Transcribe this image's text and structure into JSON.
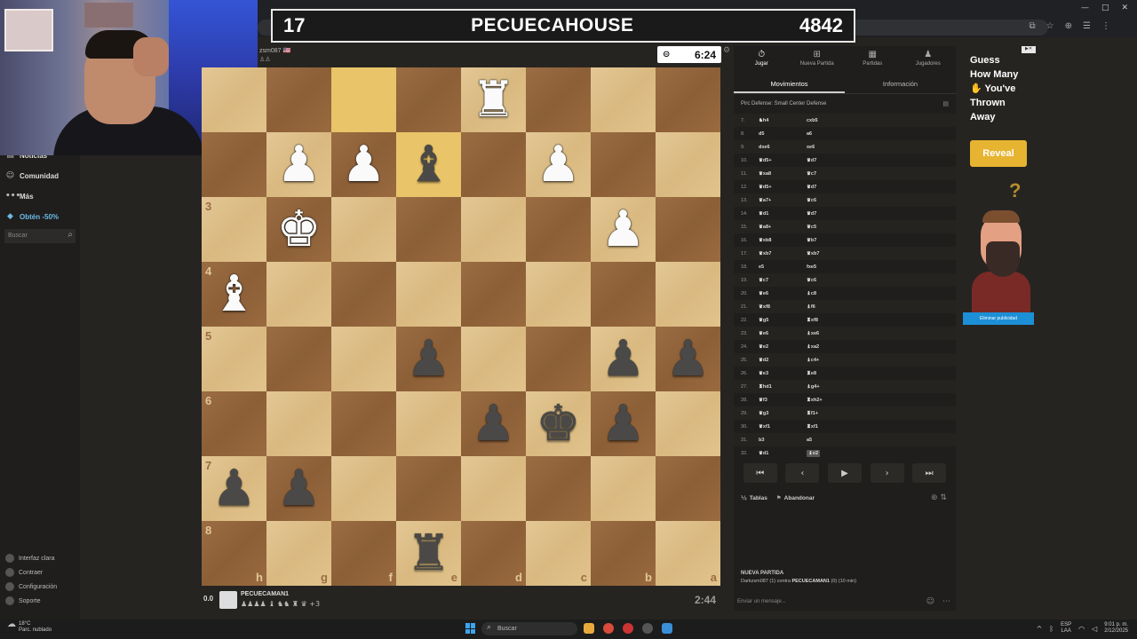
{
  "banner": {
    "left": "17",
    "name": "PECUECAHOUSE",
    "right": "4842"
  },
  "opponent": {
    "name": "zsm087",
    "flag": "🇺🇸",
    "pieces": "♙♙"
  },
  "top_clock": {
    "icon": "stopwatch-icon",
    "time": "6:24"
  },
  "player": {
    "eval": "0.0",
    "name": "PECUECAMAN1",
    "captured": "♟♟♟♟ ♝ ♞♞ ♜ ♛ +3"
  },
  "bottom_clock": {
    "time": "2:44"
  },
  "sidebar": {
    "items": [
      {
        "label": "Noticias",
        "icon": "news-icon",
        "glyph": "▤"
      },
      {
        "label": "Comunidad",
        "icon": "community-icon",
        "glyph": "☺"
      },
      {
        "label": "Más",
        "icon": "more-icon",
        "glyph": "•••"
      },
      {
        "label": "Obtén -50%",
        "icon": "diamond-icon",
        "glyph": "◆"
      }
    ],
    "search_placeholder": "Buscar",
    "bottom": [
      {
        "label": "Interfaz clara"
      },
      {
        "label": "Contraer"
      },
      {
        "label": "Configuración"
      },
      {
        "label": "Soporte"
      }
    ]
  },
  "board": {
    "ranks": [
      "",
      "",
      "3",
      "4",
      "5",
      "6",
      "7",
      "8"
    ],
    "files": [
      "h",
      "g",
      "f",
      "e",
      "d",
      "c",
      "b",
      "a"
    ],
    "rows": [
      [
        "",
        "",
        "",
        "",
        "♜",
        "",
        "",
        ""
      ],
      [
        "",
        "♟",
        "♟",
        "♝",
        "",
        "♟",
        "",
        ""
      ],
      [
        "",
        "♚",
        "",
        "",
        "",
        "",
        "♟",
        ""
      ],
      [
        "♝",
        "",
        "",
        "",
        "",
        "",
        "",
        ""
      ],
      [
        "",
        "",
        "",
        "♟",
        "",
        "",
        "♟",
        "♟"
      ],
      [
        "",
        "",
        "",
        "",
        "♟",
        "♚",
        "♟",
        ""
      ],
      [
        "♟",
        "♟",
        "",
        "",
        "",
        "",
        "",
        ""
      ],
      [
        "",
        "",
        "",
        "♜",
        "",
        "",
        "",
        ""
      ]
    ],
    "colors": [
      [
        "",
        "",
        "",
        "",
        "w",
        "",
        "",
        ""
      ],
      [
        "",
        "w",
        "w",
        "b",
        "",
        "w",
        "",
        ""
      ],
      [
        "",
        "w",
        "",
        "",
        "",
        "",
        "w",
        ""
      ],
      [
        "w",
        "",
        "",
        "",
        "",
        "",
        "",
        ""
      ],
      [
        "",
        "",
        "",
        "b",
        "",
        "",
        "b",
        "b"
      ],
      [
        "",
        "",
        "",
        "",
        "b",
        "b",
        "b",
        ""
      ],
      [
        "b",
        "b",
        "",
        "",
        "",
        "",
        "",
        ""
      ],
      [
        "",
        "",
        "",
        "b",
        "",
        "",
        "",
        ""
      ]
    ],
    "highlight": [
      [
        0,
        2
      ],
      [
        1,
        3
      ]
    ]
  },
  "panel": {
    "tabs": [
      {
        "label": "Jugar",
        "icon": "play-icon",
        "glyph": "⏱",
        "active": true
      },
      {
        "label": "Nueva Partida",
        "icon": "new-game-icon",
        "glyph": "⊞"
      },
      {
        "label": "Partidas",
        "icon": "games-icon",
        "glyph": "▦"
      },
      {
        "label": "Jugadores",
        "icon": "players-icon",
        "glyph": "♟"
      }
    ],
    "subtabs": [
      {
        "label": "Movimientos",
        "active": true
      },
      {
        "label": "Información"
      }
    ],
    "opening": "Pirc Defense: Small Center Defense",
    "moves": [
      {
        "n": "7.",
        "w": "♞h4",
        "b": "cxb5"
      },
      {
        "n": "8.",
        "w": "d5",
        "b": "a6"
      },
      {
        "n": "9.",
        "w": "dxe6",
        "b": "xe6"
      },
      {
        "n": "10.",
        "w": "♛d5+",
        "b": "♛d7"
      },
      {
        "n": "11.",
        "w": "♛xa8",
        "b": "♛c7"
      },
      {
        "n": "12.",
        "w": "♛d5+",
        "b": "♛d7"
      },
      {
        "n": "13.",
        "w": "♛a7+",
        "b": "♛c6"
      },
      {
        "n": "14.",
        "w": "♛d1",
        "b": "♛d7"
      },
      {
        "n": "15.",
        "w": "♛a8+",
        "b": "♛c5"
      },
      {
        "n": "16.",
        "w": "♛xb8",
        "b": "♛b7"
      },
      {
        "n": "17.",
        "w": "♛xb7",
        "b": "♛xb7"
      },
      {
        "n": "18.",
        "w": "e5",
        "b": "fxe5"
      },
      {
        "n": "19.",
        "w": "♛c7",
        "b": "♛c6"
      },
      {
        "n": "20.",
        "w": "♛e6",
        "b": "♝c8"
      },
      {
        "n": "21.",
        "w": "♛xf8",
        "b": "♝f6"
      },
      {
        "n": "22.",
        "w": "♛g5",
        "b": "♜xf8"
      },
      {
        "n": "23.",
        "w": "♛e6",
        "b": "♝xe6"
      },
      {
        "n": "24.",
        "w": "♛e2",
        "b": "♝xa2"
      },
      {
        "n": "25.",
        "w": "♛d2",
        "b": "♝c4+"
      },
      {
        "n": "26.",
        "w": "♛e3",
        "b": "♜e8"
      },
      {
        "n": "27.",
        "w": "♜hd1",
        "b": "♝g4+"
      },
      {
        "n": "28.",
        "w": "♛f3",
        "b": "♜xh2+"
      },
      {
        "n": "29.",
        "w": "♛g3",
        "b": "♜f1+"
      },
      {
        "n": "30.",
        "w": "♛xf1",
        "b": "♜xf1"
      },
      {
        "n": "31.",
        "w": "b3",
        "b": "a5"
      },
      {
        "n": "32.",
        "w": "♛d1",
        "b": "♝e2",
        "current": true
      }
    ],
    "nav": [
      "⏮",
      "‹",
      "▶",
      "›",
      "⏭"
    ],
    "draw_label": "Tablas",
    "resign_label": "Abandonar",
    "new_game_title": "NUEVA PARTIDA",
    "new_game_detail_a": "Darkzsm087 (1) contra ",
    "new_game_detail_b": "PECUECAMAN1",
    "new_game_detail_c": " (0) (10 min)",
    "chat_placeholder": "Enviar un mensaje..."
  },
  "ad": {
    "title_lines": [
      "Guess",
      "How Many",
      "✋ You've",
      "Thrown",
      "Away"
    ],
    "button": "Reveal",
    "footer": "Eliminar publicidad"
  },
  "taskbar": {
    "temp": "18°C",
    "weather": "Parc. nublado",
    "search": "Buscar",
    "lang_top": "ESP",
    "lang_bottom": "LAA",
    "time": "9:01 p. m.",
    "date": "2/12/2025"
  }
}
